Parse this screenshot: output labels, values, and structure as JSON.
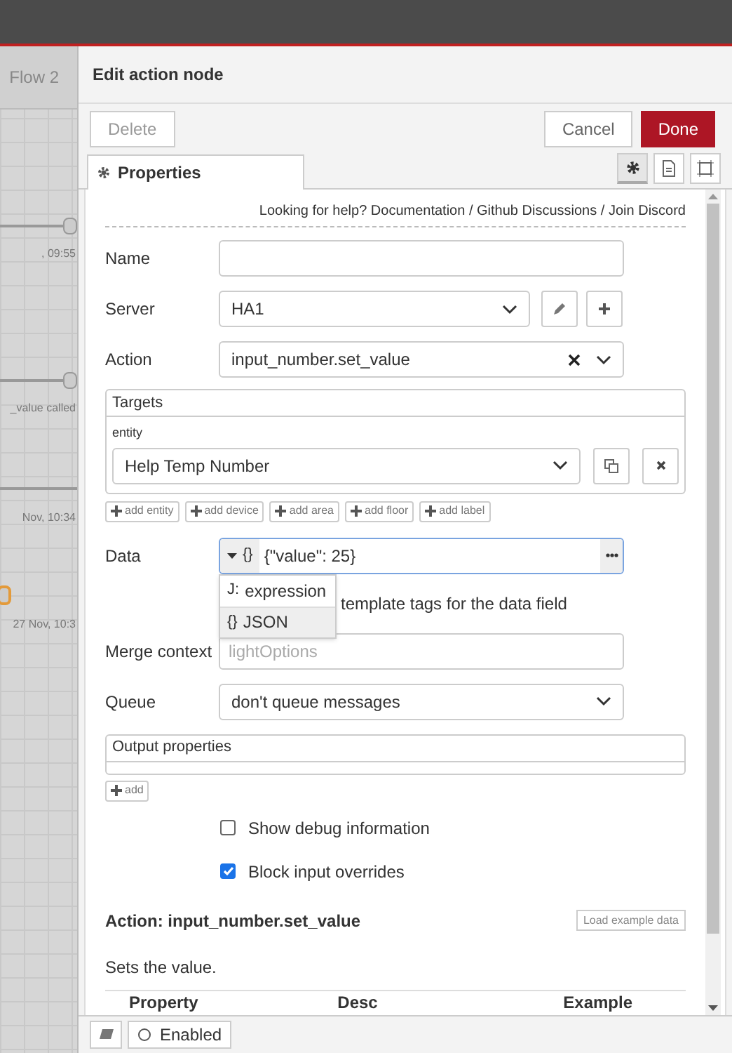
{
  "canvas": {
    "tab": "Flow 2",
    "labels": [
      ", 09:55",
      "_value called",
      "Nov, 10:34",
      "27 Nov, 10:3"
    ]
  },
  "tray": {
    "title": "Edit action node",
    "delete": "Delete",
    "cancel": "Cancel",
    "done": "Done"
  },
  "tabs": [
    {
      "label": "Properties",
      "selected": true
    }
  ],
  "side_tabs": [
    {
      "kind": "settings",
      "selected": true
    },
    {
      "kind": "info",
      "selected": false
    },
    {
      "kind": "frame",
      "selected": false
    }
  ],
  "help": {
    "prefix": "Looking for help?",
    "separator": "/",
    "links": [
      "Documentation",
      "Github Discussions",
      "Join Discord"
    ]
  },
  "name": {
    "label": "Name"
  },
  "server": {
    "label": "Server",
    "value": "HA1"
  },
  "action": {
    "label": "Action",
    "value": "input_number.set_value"
  },
  "targets": {
    "title": "Targets",
    "sublabel": "entity",
    "value": "Help Temp Number",
    "add_buttons": [
      "add entity",
      "add device",
      "add area",
      "add floor",
      "add label"
    ]
  },
  "data": {
    "label": "Data",
    "type_icon": "{}",
    "value": "{\"value\": 25}",
    "menu": {
      "expanded": true,
      "options": [
        {
          "icon": "J:",
          "label": "expression",
          "selected": false
        },
        {
          "icon": "{}",
          "label": "JSON",
          "selected": true
        }
      ]
    },
    "template_hint": "template tags for the data field"
  },
  "merge": {
    "label": "Merge context",
    "placeholder": "lightOptions"
  },
  "queue": {
    "label": "Queue",
    "value": "don't queue messages"
  },
  "output": {
    "title": "Output properties",
    "add": "add"
  },
  "checkboxes": [
    {
      "label": "Show debug information",
      "checked": false
    },
    {
      "label": "Block input overrides",
      "checked": true
    }
  ],
  "docs": {
    "heading": "Action: input_number.set_value",
    "load_button": "Load example data",
    "description": "Sets the value.",
    "columns": [
      "Property",
      "Desc",
      "Example"
    ]
  },
  "footer": {
    "enabled": "Enabled"
  }
}
